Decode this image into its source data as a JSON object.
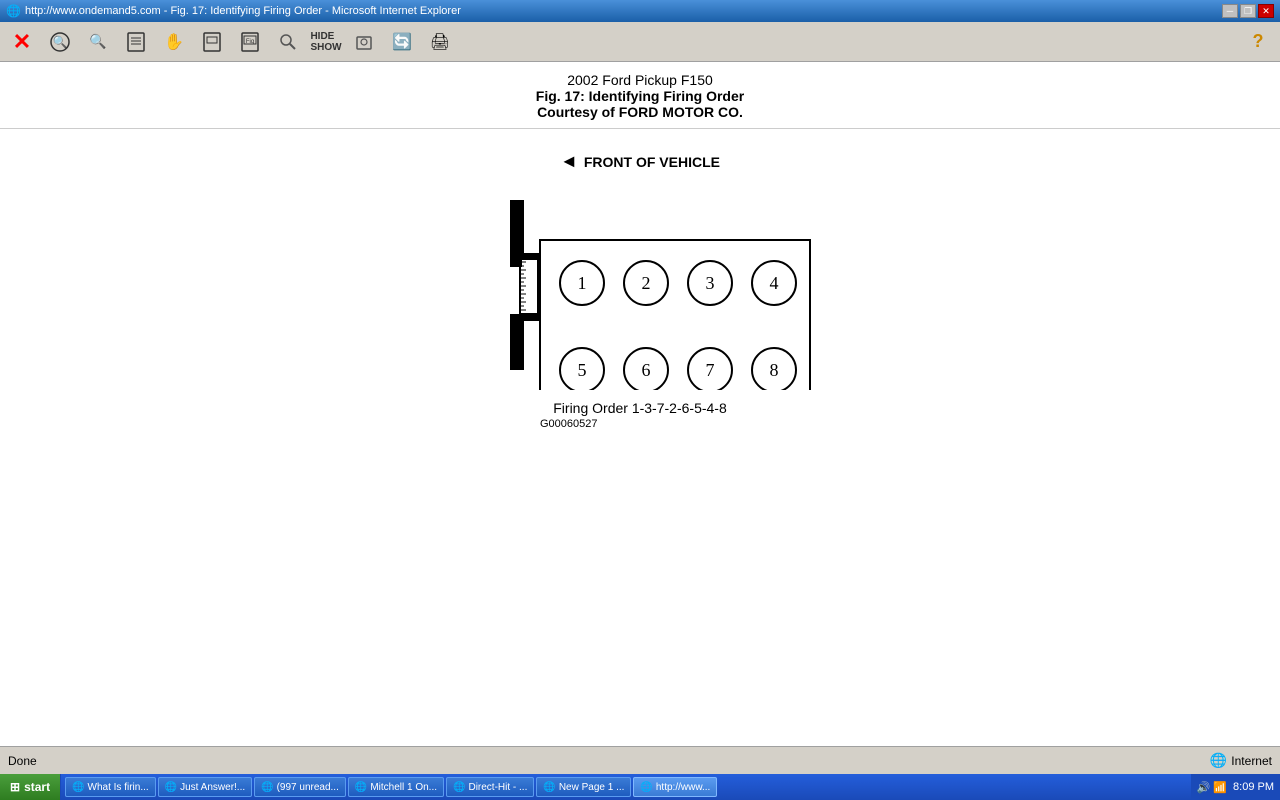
{
  "titlebar": {
    "title": "http://www.ondemand5.com - Fig. 17: Identifying Firing Order - Microsoft Internet Explorer",
    "icon": "🌐"
  },
  "winbuttons": {
    "minimize": "─",
    "restore": "❐",
    "close": "✕"
  },
  "toolbar": {
    "buttons": [
      {
        "name": "close-btn",
        "symbol": "✕",
        "style": "red"
      },
      {
        "name": "back-btn",
        "symbol": "🔍"
      },
      {
        "name": "search-btn",
        "symbol": "🔍"
      },
      {
        "name": "fig-btn",
        "symbol": "📋"
      },
      {
        "name": "hand-btn",
        "symbol": "✋"
      },
      {
        "name": "fig2-btn",
        "symbol": "📋"
      },
      {
        "name": "fig3-btn",
        "symbol": "📋"
      },
      {
        "name": "find-btn",
        "symbol": "🔍"
      },
      {
        "name": "hide-show-btn",
        "symbol": "👁"
      },
      {
        "name": "print-preview-btn",
        "symbol": "🔍"
      },
      {
        "name": "refresh-btn",
        "symbol": "🔄"
      },
      {
        "name": "print-btn",
        "symbol": "🖨"
      }
    ]
  },
  "page": {
    "title": "2002 Ford Pickup F150",
    "fig_title": "Fig. 17: Identifying Firing Order",
    "courtesy": "Courtesy of FORD MOTOR CO.",
    "front_label": "FRONT OF VEHICLE",
    "cylinders_top": [
      "①",
      "②",
      "③",
      "④"
    ],
    "cylinders_bottom": [
      "⑤",
      "⑥",
      "⑦",
      "⑧"
    ],
    "firing_order_text": "Firing Order 1-3-7-2-6-5-4-8",
    "fig_code": "G00060527"
  },
  "statusbar": {
    "status": "Done",
    "zone": "Internet"
  },
  "taskbar": {
    "start_label": "start",
    "time": "8:09 PM",
    "items": [
      {
        "label": "What Is firin...",
        "icon": "🌐",
        "active": false
      },
      {
        "label": "Just Answer!...",
        "icon": "🌐",
        "active": false
      },
      {
        "label": "(997 unread...",
        "icon": "🌐",
        "active": false
      },
      {
        "label": "Mitchell 1 On...",
        "icon": "🌐",
        "active": false
      },
      {
        "label": "Direct-Hit - ...",
        "icon": "🌐",
        "active": false
      },
      {
        "label": "New Page 1 ...",
        "icon": "🌐",
        "active": false
      },
      {
        "label": "http://www...",
        "icon": "🌐",
        "active": true
      }
    ]
  }
}
